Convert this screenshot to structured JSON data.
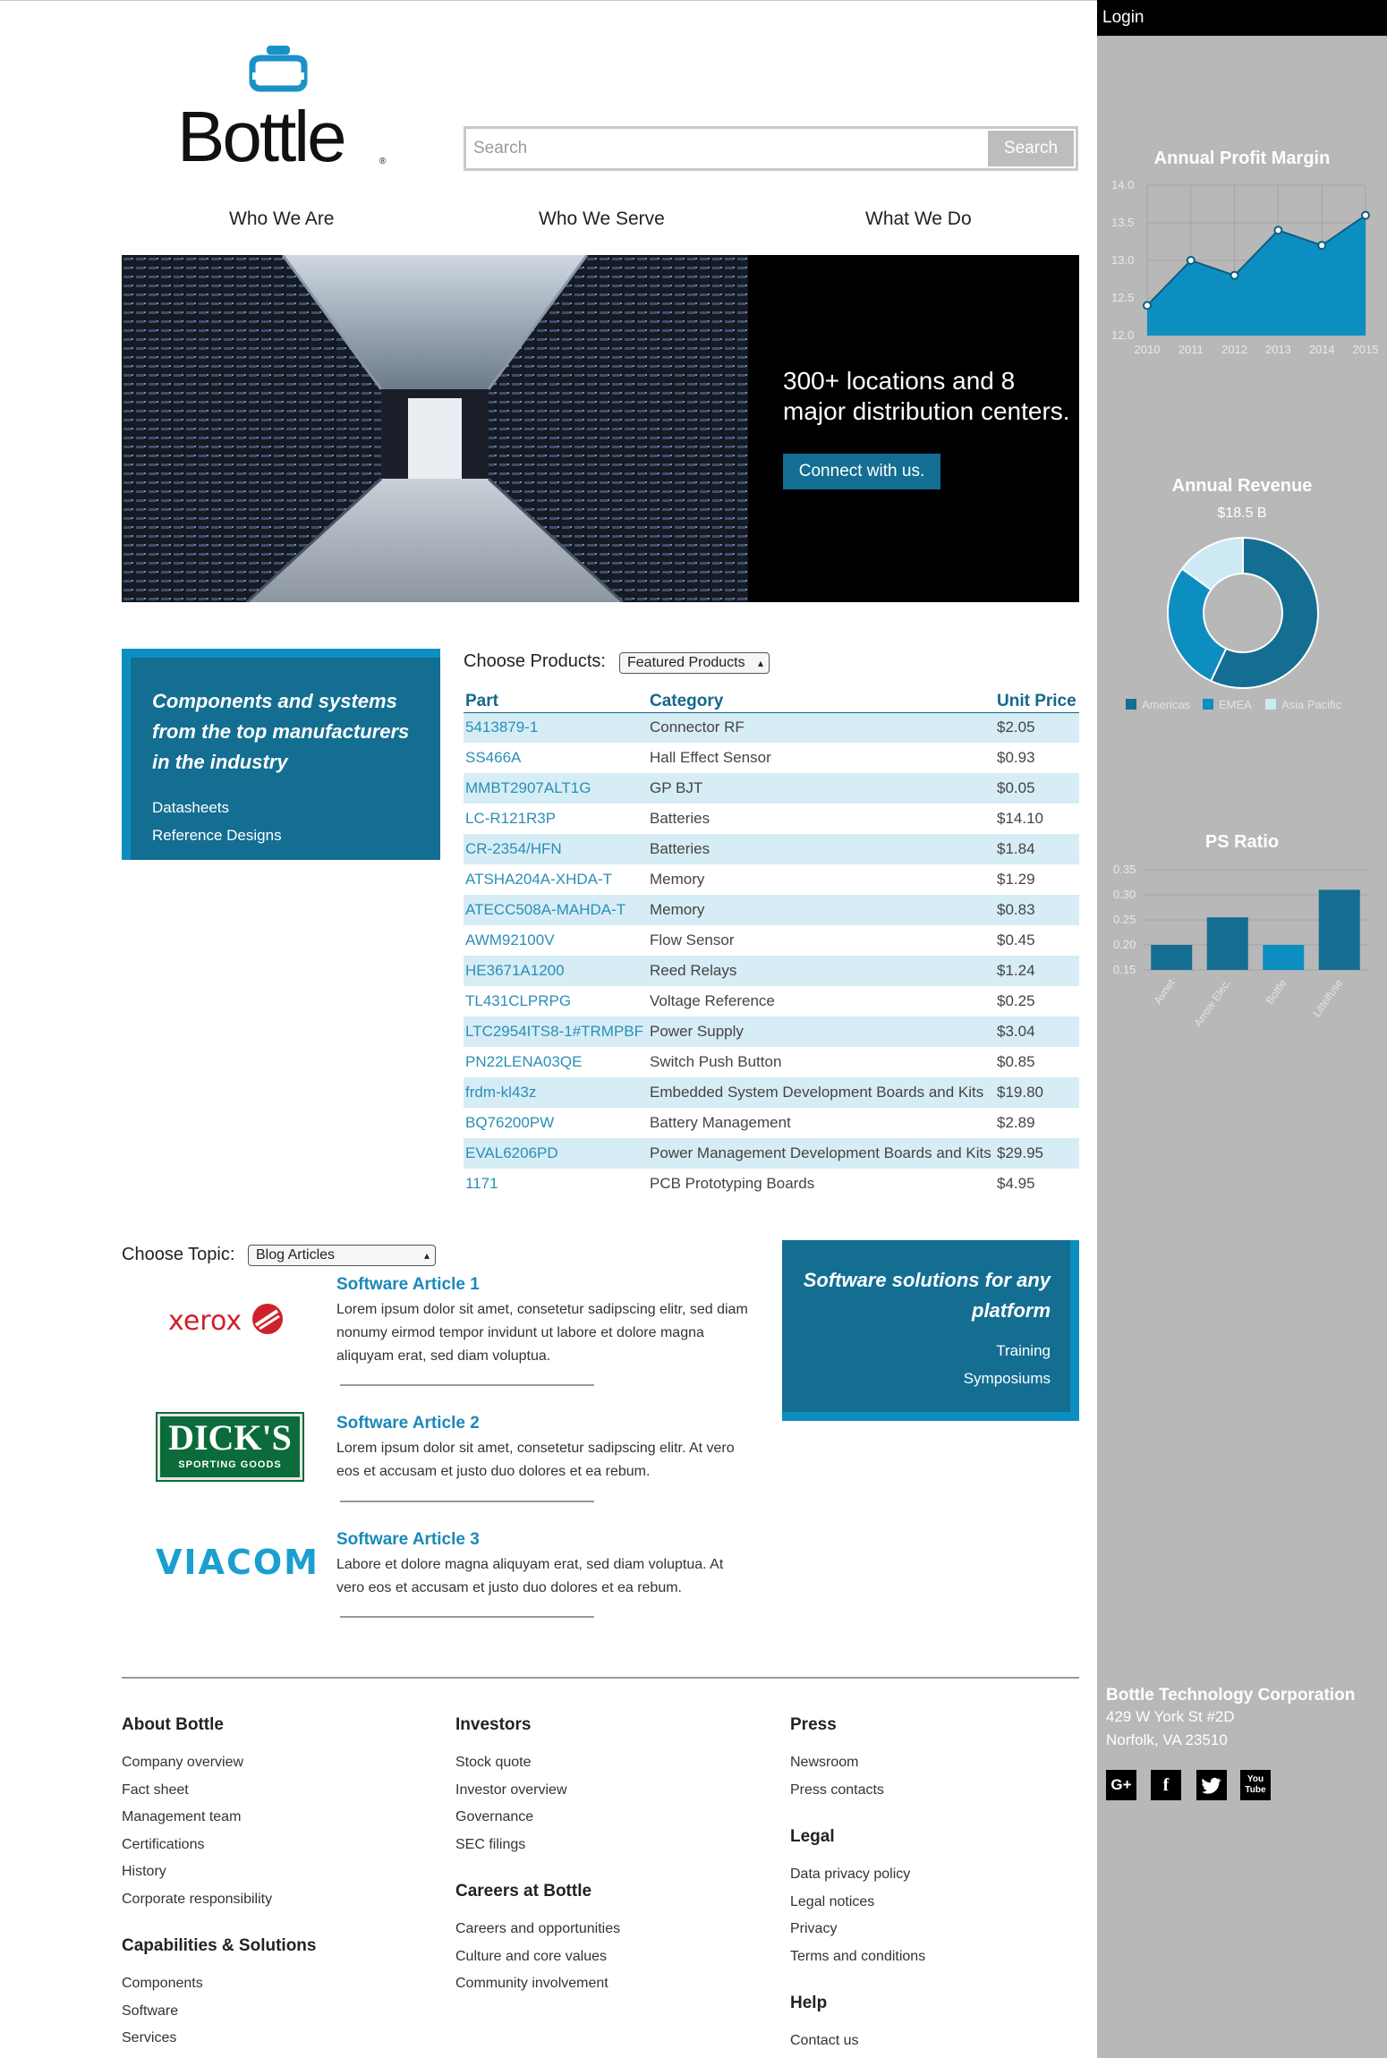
{
  "header": {
    "logo_text": "Bottle",
    "logo_mark": "®",
    "search_placeholder": "Search",
    "search_button": "Search"
  },
  "nav": {
    "items": [
      "Who We Are",
      "Who We Serve",
      "What We Do"
    ]
  },
  "hero": {
    "headline": "300+ locations and 8 major distribution centers.",
    "button": "Connect with us."
  },
  "promo_left": {
    "title": "Components and systems from the top manufacturers in the industry",
    "links": [
      "Datasheets",
      "Reference Designs"
    ]
  },
  "products": {
    "label": "Choose Products:",
    "selected": "Featured Products",
    "headers": [
      "Part",
      "Category",
      "Unit Price"
    ],
    "rows": [
      [
        "5413879-1",
        "Connector RF",
        "$2.05"
      ],
      [
        "SS466A",
        "Hall Effect Sensor",
        "$0.93"
      ],
      [
        "MMBT2907ALT1G",
        "GP BJT",
        "$0.05"
      ],
      [
        "LC-R121R3P",
        "Batteries",
        "$14.10"
      ],
      [
        "CR-2354/HFN",
        "Batteries",
        "$1.84"
      ],
      [
        "ATSHA204A-XHDA-T",
        "Memory",
        "$1.29"
      ],
      [
        "ATECC508A-MAHDA-T",
        "Memory",
        "$0.83"
      ],
      [
        "AWM92100V",
        "Flow Sensor",
        "$0.45"
      ],
      [
        "HE3671A1200",
        "Reed Relays",
        "$1.24"
      ],
      [
        "TL431CLPRPG",
        "Voltage Reference",
        "$0.25"
      ],
      [
        "LTC2954ITS8-1#TRMPBF",
        "Power Supply",
        "$3.04"
      ],
      [
        "PN22LENA03QE",
        "Switch Push Button",
        "$0.85"
      ],
      [
        "frdm-kl43z",
        "Embedded System Development Boards and Kits",
        "$19.80"
      ],
      [
        "BQ76200PW",
        "Battery Management",
        "$2.89"
      ],
      [
        "EVAL6206PD",
        "Power Management Development Boards and Kits",
        "$29.95"
      ],
      [
        "1171",
        "PCB Prototyping Boards",
        "$4.95"
      ]
    ]
  },
  "topics": {
    "label": "Choose Topic:",
    "selected": "Blog Articles",
    "articles": [
      {
        "logo": "xerox",
        "title": "Software Article 1",
        "text": "Lorem ipsum dolor sit amet, consetetur sadipscing elitr, sed diam nonumy eirmod tempor invidunt ut labore et dolore magna aliquyam erat, sed diam voluptua."
      },
      {
        "logo": "DICK'S",
        "logo_sub": "SPORTING GOODS",
        "title": "Software Article 2",
        "text": "Lorem ipsum dolor sit amet, consetetur sadipscing elitr. At vero eos et accusam et justo duo dolores et ea rebum."
      },
      {
        "logo": "VIACOM",
        "title": "Software Article 3",
        "text": "Labore et dolore magna aliquyam erat, sed diam voluptua. At vero eos et accusam et justo duo dolores et ea rebum."
      }
    ]
  },
  "promo_right": {
    "title": "Software solutions for any platform",
    "links": [
      "Training",
      "Symposiums"
    ]
  },
  "footer": {
    "about": {
      "title": "About Bottle",
      "links": [
        "Company overview",
        "Fact sheet",
        "Management team",
        "Certifications",
        "History",
        "Corporate responsibility"
      ]
    },
    "capabilities": {
      "title": "Capabilities & Solutions",
      "links": [
        "Components",
        "Software",
        "Services"
      ]
    },
    "investors": {
      "title": "Investors",
      "links": [
        "Stock quote",
        "Investor overview",
        "Governance",
        "SEC filings"
      ]
    },
    "careers": {
      "title": "Careers at Bottle",
      "links": [
        "Careers and opportunities",
        "Culture and core values",
        "Community involvement"
      ]
    },
    "press": {
      "title": "Press",
      "links": [
        "Newsroom",
        "Press contacts"
      ]
    },
    "legal": {
      "title": "Legal",
      "links": [
        "Data privacy policy",
        "Legal notices",
        "Privacy",
        "Terms and conditions"
      ]
    },
    "help": {
      "title": "Help",
      "links": [
        "Contact us"
      ]
    }
  },
  "sidebar": {
    "login": "Login",
    "corp_name": "Bottle Technology Corporation",
    "address1": "429 W York St #2D",
    "address2": "Norfolk, VA 23510",
    "social": [
      "google-plus-icon",
      "facebook-icon",
      "twitter-icon",
      "youtube-icon"
    ]
  },
  "colors": {
    "accent": "#136e92",
    "accent_bright": "#0d8ec1",
    "link": "#2a8eb8",
    "sidebar": "#b8b8b8"
  },
  "chart_data": [
    {
      "type": "area",
      "title": "Annual Profit Margin",
      "x": [
        "2010",
        "2011",
        "2012",
        "2013",
        "2014",
        "2015"
      ],
      "values": [
        12.4,
        13.0,
        12.8,
        13.4,
        13.2,
        13.6
      ],
      "ylim": [
        12.0,
        14.0
      ],
      "yticks": [
        "12.0",
        "12.5",
        "13.0",
        "13.5",
        "14.0"
      ],
      "grid": true,
      "color": "#0d8ec1"
    },
    {
      "type": "pie",
      "title": "Annual Revenue",
      "subtitle": "$18.5 B",
      "categories": [
        "Americas",
        "EMEA",
        "Asia Pacific"
      ],
      "values": [
        57,
        28,
        15
      ],
      "colors": [
        "#136e92",
        "#0d8ec1",
        "#cde9f4"
      ],
      "legend": "bottom"
    },
    {
      "type": "bar",
      "title": "PS Ratio",
      "categories": [
        "Avnet",
        "Arrow Elec.",
        "Bottle",
        "Littelfuse"
      ],
      "values": [
        0.2,
        0.255,
        0.2,
        0.31
      ],
      "ylim": [
        0.15,
        0.35
      ],
      "yticks": [
        "0.15",
        "0.20",
        "0.25",
        "0.30",
        "0.35"
      ],
      "colors": [
        "#136e92",
        "#136e92",
        "#0d8ec1",
        "#136e92"
      ],
      "grid": true
    }
  ]
}
